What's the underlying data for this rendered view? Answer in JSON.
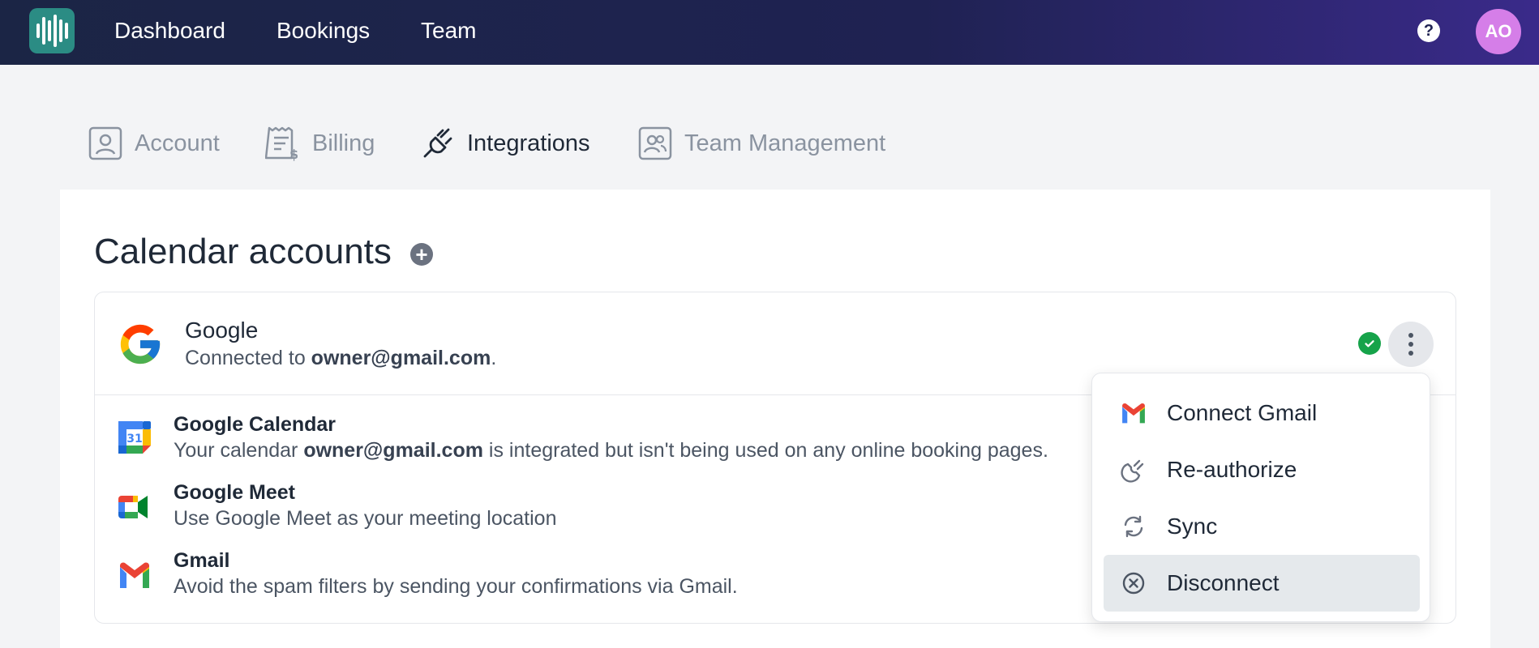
{
  "nav": {
    "links": [
      "Dashboard",
      "Bookings",
      "Team"
    ],
    "help_symbol": "?",
    "avatar_initials": "AO"
  },
  "tabs": [
    {
      "label": "Account",
      "icon": "user-square-icon",
      "active": false
    },
    {
      "label": "Billing",
      "icon": "receipt-icon",
      "active": false
    },
    {
      "label": "Integrations",
      "icon": "plug-icon",
      "active": true
    },
    {
      "label": "Team Management",
      "icon": "users-square-icon",
      "active": false
    }
  ],
  "section": {
    "title": "Calendar accounts",
    "add_symbol": "+"
  },
  "account": {
    "provider": "Google",
    "connected_prefix": "Connected to ",
    "email": "owner@gmail.com",
    "connected_suffix": ".",
    "status_color": "#16a34a"
  },
  "services": [
    {
      "name": "Google Calendar",
      "icon": "google-calendar-icon",
      "desc_prefix": "Your calendar ",
      "desc_bold": "owner@gmail.com",
      "desc_suffix": " is integrated but isn't being used on any online booking pages."
    },
    {
      "name": "Google Meet",
      "icon": "google-meet-icon",
      "desc_prefix": "Use Google Meet as your meeting location",
      "desc_bold": "",
      "desc_suffix": ""
    },
    {
      "name": "Gmail",
      "icon": "gmail-icon",
      "desc_prefix": "Avoid the spam filters by sending your confirmations via Gmail.",
      "desc_bold": "",
      "desc_suffix": ""
    }
  ],
  "menu": {
    "items": [
      {
        "label": "Connect Gmail",
        "icon": "gmail-icon"
      },
      {
        "label": "Re-authorize",
        "icon": "plug-icon"
      },
      {
        "label": "Sync",
        "icon": "sync-icon"
      },
      {
        "label": "Disconnect",
        "icon": "x-circle-icon",
        "highlighted": true
      }
    ]
  },
  "colors": {
    "brand": "#2b8c84",
    "nav_bg": "#1b2545",
    "avatar": "#d57ee8"
  }
}
